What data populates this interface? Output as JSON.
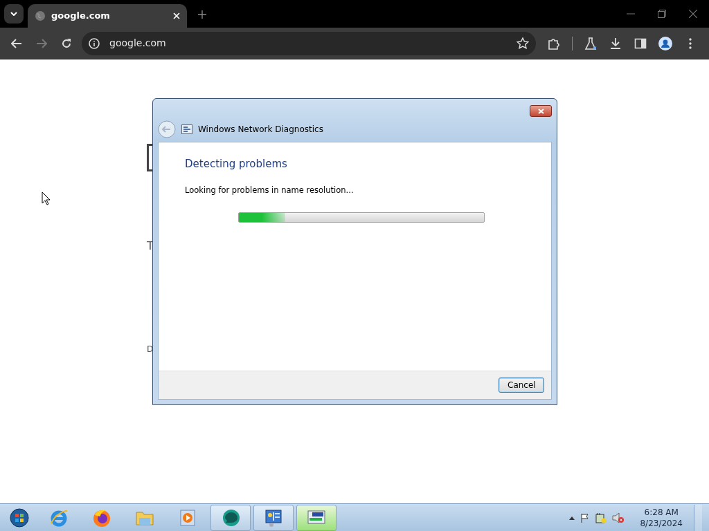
{
  "browser": {
    "tabs": [
      {
        "title": "google.com",
        "selected": true
      }
    ],
    "address": "google.com"
  },
  "page": {
    "fragments": [
      {
        "kind": "text",
        "text": "T"
      },
      {
        "kind": "small",
        "text": "D"
      }
    ]
  },
  "dialog": {
    "title": "Windows Network Diagnostics",
    "heading": "Detecting problems",
    "status": "Looking for problems in name resolution...",
    "progress": {
      "level": 0.19
    },
    "buttons": [
      "Cancel"
    ]
  },
  "taskbar": {
    "items": [
      {
        "kind": "start"
      },
      {
        "kind": "pinned"
      },
      {
        "kind": "pinned"
      },
      {
        "kind": "pinned"
      },
      {
        "kind": "pinned"
      },
      {
        "kind": "open",
        "selected": false
      },
      {
        "kind": "open",
        "selected": false
      },
      {
        "kind": "open",
        "selected": true
      }
    ],
    "clock": {
      "time": "6:28 AM",
      "date": "8/23/2024"
    }
  }
}
